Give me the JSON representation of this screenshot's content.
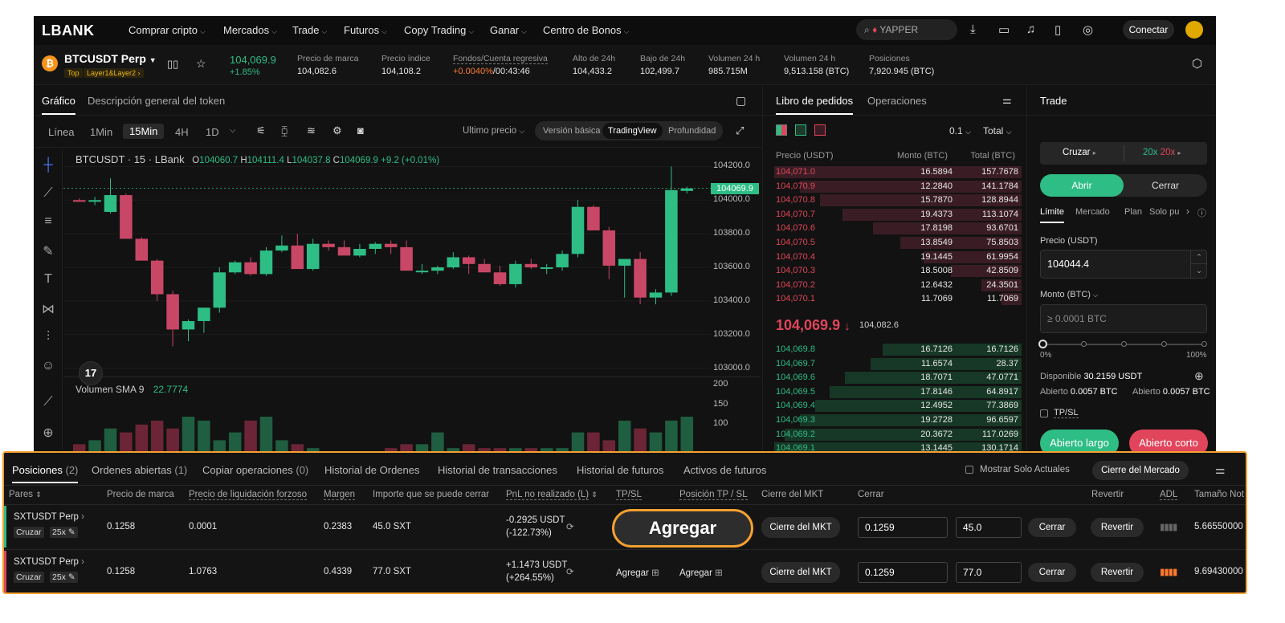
{
  "nav": {
    "logo": "LBANK",
    "items": [
      "Comprar cripto",
      "Mercados",
      "Trade",
      "Futuros",
      "Copy Trading",
      "Ganar",
      "Centro de Bonos"
    ],
    "search_text": "YAPPER",
    "connect": "Conectar"
  },
  "ticker": {
    "symbol": "BTCUSDT Perp",
    "tag1": "Top",
    "tag2": "Layer1&Layer2",
    "price": "104,069.9",
    "change": "+1.85%",
    "stats": [
      {
        "label": "Precio de marca",
        "value": "104,082.6"
      },
      {
        "label": "Precio índice",
        "value": "104,108.2"
      },
      {
        "label": "Fondos/Cuenta regresiva",
        "value_a": "+0.0040%",
        "value_b": "/00:43:46"
      },
      {
        "label": "Alto de 24h",
        "value": "104,433.2"
      },
      {
        "label": "Bajo de 24h",
        "value": "102,499.7"
      },
      {
        "label": "Volumen 24 h",
        "value": "985.715M"
      },
      {
        "label": "Volumen 24 h",
        "value": "9,513.158 (BTC)"
      },
      {
        "label": "Posiciones",
        "value": "7,920.945 (BTC)"
      }
    ]
  },
  "chart_tabs": [
    "Gráfico",
    "Descripción general del token"
  ],
  "timeframes": [
    "Línea",
    "1Min",
    "15Min",
    "4H",
    "1D"
  ],
  "price_select": "Ultimo precio",
  "modes": [
    "Versión básica",
    "TradingView",
    "Profundidad"
  ],
  "legend": {
    "name": "BTCUSDT · 15 · LBank",
    "o": "104060.7",
    "h": "104111.4",
    "l": "104037.8",
    "c": "104069.9",
    "chg": "+9.2 (+0.01%)"
  },
  "volume_legend": {
    "name": "Volumen SMA 9",
    "value": "22.7774"
  },
  "current_price_tag": "104069.9",
  "chart_data": {
    "type": "candlestick",
    "y_ticks": [
      "104200.0",
      "104000.0",
      "103800.0",
      "103600.0",
      "103400.0",
      "103200.0",
      "103000.0"
    ],
    "ylim": [
      102950,
      104250
    ],
    "candles": [
      {
        "o": 104000,
        "h": 104010,
        "l": 103990,
        "c": 103995
      },
      {
        "o": 103995,
        "h": 104020,
        "l": 103970,
        "c": 104000
      },
      {
        "o": 103930,
        "h": 104130,
        "l": 103920,
        "c": 104030
      },
      {
        "o": 104030,
        "h": 104040,
        "l": 103870,
        "c": 103770
      },
      {
        "o": 103770,
        "h": 103780,
        "l": 103740,
        "c": 103640
      },
      {
        "o": 103640,
        "h": 103650,
        "l": 103400,
        "c": 103440
      },
      {
        "o": 103440,
        "h": 103460,
        "l": 103130,
        "c": 103230
      },
      {
        "o": 103230,
        "h": 103290,
        "l": 103160,
        "c": 103280
      },
      {
        "o": 103280,
        "h": 103350,
        "l": 103210,
        "c": 103360
      },
      {
        "o": 103360,
        "h": 103600,
        "l": 103330,
        "c": 103570
      },
      {
        "o": 103570,
        "h": 103640,
        "l": 103560,
        "c": 103630
      },
      {
        "o": 103630,
        "h": 103660,
        "l": 103550,
        "c": 103560
      },
      {
        "o": 103560,
        "h": 103720,
        "l": 103550,
        "c": 103700
      },
      {
        "o": 103700,
        "h": 103790,
        "l": 103690,
        "c": 103730
      },
      {
        "o": 103730,
        "h": 103800,
        "l": 103700,
        "c": 103590
      },
      {
        "o": 103590,
        "h": 103770,
        "l": 103580,
        "c": 103740
      },
      {
        "o": 103740,
        "h": 103760,
        "l": 103700,
        "c": 103720
      },
      {
        "o": 103720,
        "h": 103760,
        "l": 103690,
        "c": 103670
      },
      {
        "o": 103670,
        "h": 103740,
        "l": 103660,
        "c": 103710
      },
      {
        "o": 103710,
        "h": 103750,
        "l": 103680,
        "c": 103740
      },
      {
        "o": 103740,
        "h": 103760,
        "l": 103680,
        "c": 103720
      },
      {
        "o": 103720,
        "h": 103760,
        "l": 103590,
        "c": 103580
      },
      {
        "o": 103580,
        "h": 103620,
        "l": 103560,
        "c": 103580
      },
      {
        "o": 103580,
        "h": 103610,
        "l": 103560,
        "c": 103600
      },
      {
        "o": 103600,
        "h": 103690,
        "l": 103590,
        "c": 103660
      },
      {
        "o": 103660,
        "h": 103670,
        "l": 103560,
        "c": 103620
      },
      {
        "o": 103620,
        "h": 103650,
        "l": 103590,
        "c": 103570
      },
      {
        "o": 103570,
        "h": 103610,
        "l": 103490,
        "c": 103500
      },
      {
        "o": 103500,
        "h": 103640,
        "l": 103480,
        "c": 103620
      },
      {
        "o": 103620,
        "h": 103650,
        "l": 103590,
        "c": 103600
      },
      {
        "o": 103600,
        "h": 103620,
        "l": 103560,
        "c": 103600
      },
      {
        "o": 103600,
        "h": 103700,
        "l": 103580,
        "c": 103680
      },
      {
        "o": 103680,
        "h": 104000,
        "l": 103660,
        "c": 103960
      },
      {
        "o": 103960,
        "h": 103970,
        "l": 103850,
        "c": 103820
      },
      {
        "o": 103820,
        "h": 103840,
        "l": 103530,
        "c": 103610
      },
      {
        "o": 103610,
        "h": 103620,
        "l": 103420,
        "c": 103650
      },
      {
        "o": 103650,
        "h": 103690,
        "l": 103380,
        "c": 103420
      },
      {
        "o": 103420,
        "h": 103470,
        "l": 103380,
        "c": 103450
      },
      {
        "o": 103450,
        "h": 104200,
        "l": 103430,
        "c": 104060
      },
      {
        "o": 104055,
        "h": 104080,
        "l": 104040,
        "c": 104070
      }
    ],
    "volume_ticks": [
      "200",
      "150",
      "100"
    ],
    "volumes": [
      30,
      40,
      70,
      60,
      80,
      90,
      70,
      100,
      90,
      40,
      60,
      90,
      100,
      40,
      30,
      20,
      10,
      10,
      10,
      10,
      20,
      30,
      30,
      60,
      20,
      30,
      20,
      20,
      20,
      20,
      20,
      20,
      60,
      60,
      40,
      90,
      70,
      60,
      90,
      100
    ]
  },
  "orderbook": {
    "tabs": [
      "Libro de pedidos",
      "Operaciones"
    ],
    "precision": "0.1",
    "total_select": "Total",
    "headers": [
      "Precio (USDT)",
      "Monto (BTC)",
      "Total (BTC)"
    ],
    "asks": [
      {
        "p": "104,071.0",
        "m": "16.5894",
        "t": "157.7678",
        "d": 0.98
      },
      {
        "p": "104,070.9",
        "m": "12.2840",
        "t": "141.1784",
        "d": 0.88
      },
      {
        "p": "104,070.8",
        "m": "15.7870",
        "t": "128.8944",
        "d": 0.8
      },
      {
        "p": "104,070.7",
        "m": "19.4373",
        "t": "113.1074",
        "d": 0.71
      },
      {
        "p": "104,070.6",
        "m": "17.8198",
        "t": "93.6701",
        "d": 0.59
      },
      {
        "p": "104,070.5",
        "m": "13.8549",
        "t": "75.8503",
        "d": 0.48
      },
      {
        "p": "104,070.4",
        "m": "19.1445",
        "t": "61.9954",
        "d": 0.39
      },
      {
        "p": "104,070.3",
        "m": "18.5008",
        "t": "42.8509",
        "d": 0.28
      },
      {
        "p": "104,070.2",
        "m": "12.6432",
        "t": "24.3501",
        "d": 0.16
      },
      {
        "p": "104,070.1",
        "m": "11.7069",
        "t": "11.7069",
        "d": 0.08
      }
    ],
    "last_price": "104,069.9",
    "last_arrow": "↓",
    "mark_price": "104,082.6",
    "bids": [
      {
        "p": "104,069.8",
        "m": "16.7126",
        "t": "16.7126",
        "d": 0.55
      },
      {
        "p": "104,069.7",
        "m": "11.6574",
        "t": "28.37",
        "d": 0.6
      },
      {
        "p": "104,069.6",
        "m": "18.7071",
        "t": "47.0771",
        "d": 0.7
      },
      {
        "p": "104,069.5",
        "m": "17.8146",
        "t": "64.8917",
        "d": 0.76
      },
      {
        "p": "104,069.4",
        "m": "12.4952",
        "t": "77.3869",
        "d": 0.82
      },
      {
        "p": "104,069.3",
        "m": "19.2728",
        "t": "96.6597",
        "d": 0.88
      },
      {
        "p": "104,069.2",
        "m": "20.3672",
        "t": "117.0269",
        "d": 0.94
      },
      {
        "p": "104,069.1",
        "m": "13.1445",
        "t": "130.1714",
        "d": 0.98
      }
    ]
  },
  "trade": {
    "title": "Trade",
    "margin": "Cruzar",
    "leverage_a": "20x",
    "leverage_b": "20x",
    "open": "Abrir",
    "close": "Cerrar",
    "order_types": [
      "Límite",
      "Mercado",
      "Plan",
      "Solo pu"
    ],
    "price_label": "Precio (USDT)",
    "price_value": "104044.4",
    "amount_label": "Monto (BTC)",
    "amount_placeholder": "≥ 0.0001 BTC",
    "slider_min": "0%",
    "slider_max": "100%",
    "available_label": "Disponible",
    "available_value": "30.2159 USDT",
    "open_a_label": "Abierto",
    "open_a_value": "0.0057 BTC",
    "open_b_label": "Abierto",
    "open_b_value": "0.0057 BTC",
    "tpsl": "TP/SL",
    "long": "Abierto largo",
    "short": "Abierto corto"
  },
  "positions": {
    "tabs": [
      {
        "label": "Posiciones",
        "count": "(2)"
      },
      {
        "label": "Ordenes abiertas",
        "count": "(1)"
      },
      {
        "label": "Copiar operaciones",
        "count": "(0)"
      },
      {
        "label": "Historial de Ordenes",
        "count": ""
      },
      {
        "label": "Historial de transacciones",
        "count": ""
      },
      {
        "label": "Historial de futuros",
        "count": ""
      },
      {
        "label": "Activos de futuros",
        "count": ""
      }
    ],
    "show_current": "Mostrar Solo Actuales",
    "market_close_all": "Cierre del Mercado",
    "headers": [
      "Pares",
      "Precio de marca",
      "Precio de liquidación forzoso",
      "Margen",
      "Importe que se puede cerrar",
      "PnL no realizado (L)",
      "TP/SL",
      "Posición TP / SL",
      "Cierre del MKT",
      "Cerrar",
      "Revertir",
      "ADL",
      "Tamaño Not"
    ],
    "rows": [
      {
        "pair": "SXTUSDT Perp",
        "margin_mode": "Cruzar",
        "lev": "25x",
        "mark": "0.1258",
        "liq": "0.0001",
        "margin": "0.2383",
        "closable": "45.0 SXT",
        "pnl_a": "-0.2925 USDT",
        "pnl_b": "(-122.73%)",
        "tpsl": "",
        "pos_tpsl": "",
        "mkt": "Cierre del MKT",
        "close_price": "0.1259",
        "close_qty": "45.0",
        "close": "Cerrar",
        "revert": "Revertir",
        "size": "5.66550000"
      },
      {
        "pair": "SXTUSDT Perp",
        "margin_mode": "Cruzar",
        "lev": "25x",
        "mark": "0.1258",
        "liq": "1.0763",
        "margin": "0.4339",
        "closable": "77.0 SXT",
        "pnl_a": "+1.1473 USDT",
        "pnl_b": "(+264.55%)",
        "tpsl": "Agregar",
        "pos_tpsl": "Agregar",
        "mkt": "Cierre del MKT",
        "close_price": "0.1259",
        "close_qty": "77.0",
        "close": "Cerrar",
        "revert": "Revertir",
        "size": "9.69430000"
      }
    ]
  },
  "callout": "Agregar"
}
